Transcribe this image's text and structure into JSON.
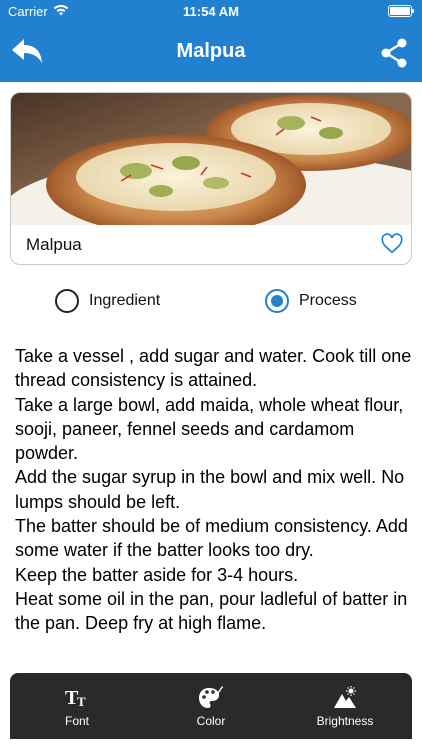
{
  "status_bar": {
    "carrier": "Carrier",
    "time": "11:54 AM",
    "wifi_icon": "wifi-icon",
    "battery_icon": "battery-icon"
  },
  "nav_bar": {
    "title": "Malpua",
    "back_icon": "reply-arrow-icon",
    "share_icon": "share-icon",
    "color": "#2180d0"
  },
  "recipe_card": {
    "name": "Malpua",
    "image": "malpua-photo",
    "favorite_icon": "heart-outline-icon"
  },
  "tabs": {
    "options": [
      {
        "label": "Ingredient",
        "selected": false
      },
      {
        "label": "Process",
        "selected": true
      }
    ]
  },
  "process": {
    "lines": [
      "Take a vessel , add sugar and water. Cook till one thread consistency is attained.",
      "Take a large bowl, add maida, whole wheat flour, sooji, paneer, fennel seeds and cardamom powder.",
      "Add the sugar syrup in the bowl and mix well. No lumps should be left.",
      "The batter should be of medium consistency. Add some water if the batter looks too dry.",
      "Keep the batter aside for 3-4 hours.",
      "Heat some oil in the pan, pour ladleful of batter in the pan. Deep fry at high flame."
    ]
  },
  "toolbar": {
    "items": [
      {
        "label": "Font",
        "icon": "font-size-icon"
      },
      {
        "label": "Color",
        "icon": "palette-icon"
      },
      {
        "label": "Brightness",
        "icon": "brightness-icon"
      }
    ],
    "background": "#2a2a2a"
  }
}
